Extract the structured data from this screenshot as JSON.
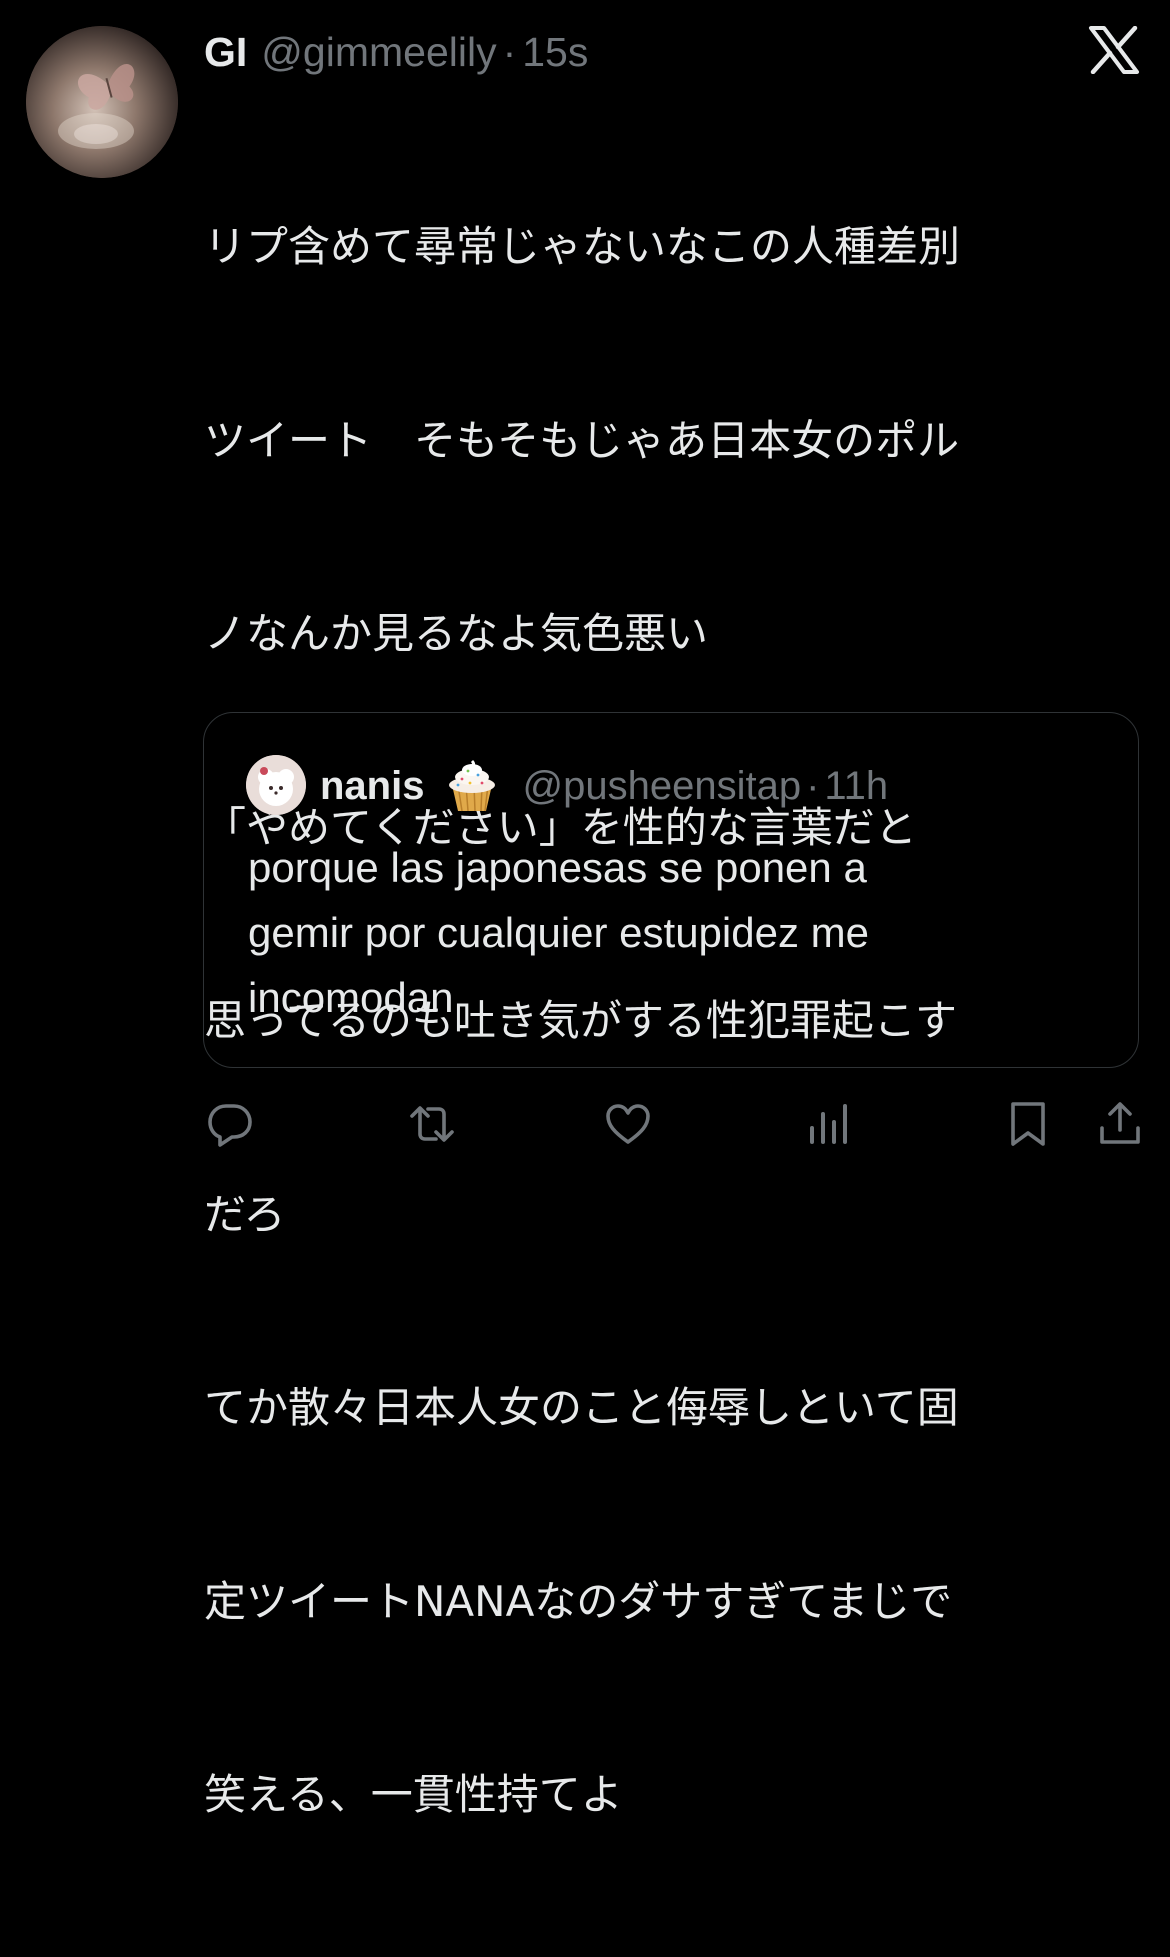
{
  "tweet": {
    "author": {
      "display_name": "GI",
      "handle": "@gimmeelily",
      "separator": "·",
      "time": "15s"
    },
    "text_lines": [
      "リプ含めて尋常じゃないなこの人種差別",
      "ツイート　そもそもじゃあ日本女のポル",
      "ノなんか見るなよ気色悪い",
      "「やめてください」を性的な言葉だと",
      "思ってるのも吐き気がする性犯罪起こす",
      "だろ",
      "てか散々日本人女のこと侮辱しといて固",
      "定ツイートNANAなのダサすぎてまじで",
      "笑える、一貫性持てよ"
    ],
    "brand_icon": "x-logo-icon"
  },
  "quoted_tweet": {
    "author": {
      "display_name": "nanis",
      "emoji": "cupcake-icon",
      "handle": "@pusheensitap",
      "separator": "·",
      "time": "11h"
    },
    "text_lines": [
      "porque las japonesas se ponen a",
      "gemir por cualquier estupidez me",
      "incomodan"
    ]
  },
  "actions": [
    {
      "name": "reply",
      "icon": "reply-icon"
    },
    {
      "name": "repost",
      "icon": "repost-icon"
    },
    {
      "name": "like",
      "icon": "heart-icon"
    },
    {
      "name": "views",
      "icon": "views-icon"
    },
    {
      "name": "bookmark",
      "icon": "bookmark-icon"
    },
    {
      "name": "share",
      "icon": "share-icon"
    }
  ],
  "colors": {
    "background": "#000000",
    "text_primary": "#e7e9ea",
    "text_secondary": "#71767b",
    "border": "#2f3336"
  }
}
